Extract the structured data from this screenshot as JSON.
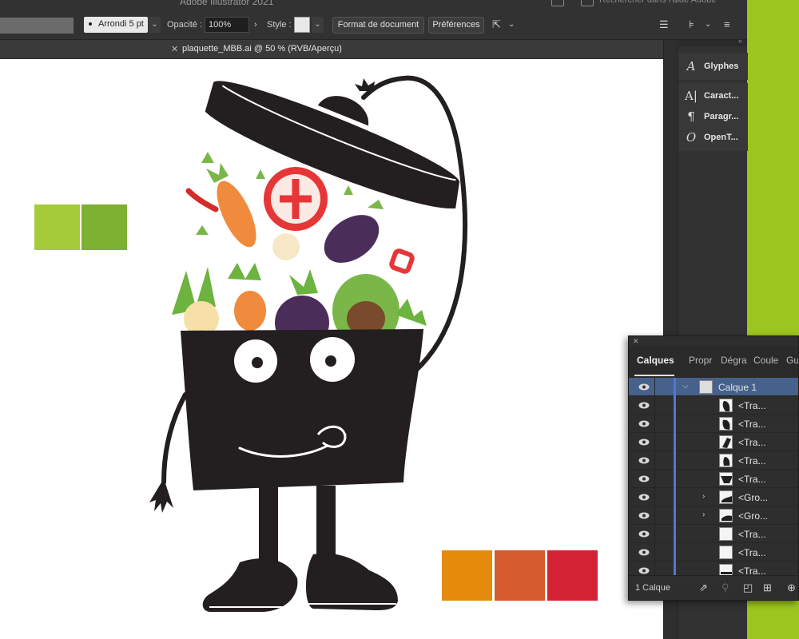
{
  "app": {
    "title": "Adobe Illustrator 2021",
    "search_placeholder": "Rechercher dans l'aide Adobe"
  },
  "control_bar": {
    "brush_value": "Arrondi 5 pt",
    "opacity_label": "Opacité :",
    "opacity_value": "100%",
    "style_label": "Style :",
    "document_setup_button": "Format de document",
    "preferences_button": "Préférences"
  },
  "document_tab": {
    "title": "plaquette_MBB.ai @ 50 % (RVB/Aperçu)"
  },
  "dock": {
    "items": [
      {
        "label": "Glyphes",
        "icon": "glyphs-icon",
        "glyph": "A"
      },
      {
        "label": "Caract...",
        "icon": "character-icon",
        "glyph": "A|"
      },
      {
        "label": "Paragr...",
        "icon": "paragraph-icon",
        "glyph": "¶"
      },
      {
        "label": "OpenT...",
        "icon": "opentype-icon",
        "glyph": "O"
      }
    ]
  },
  "swatches": {
    "greens": [
      "#a5cb3a",
      "#7eb032"
    ],
    "warms": [
      "#e48b0c",
      "#d55a2c",
      "#d42235"
    ]
  },
  "layers_panel": {
    "tabs": [
      "Calques",
      "Propr",
      "Dégra",
      "Coule",
      "Gu"
    ],
    "rows": [
      {
        "name": "Calque 1",
        "expanded": true,
        "top_level": true
      },
      {
        "name": "<Tra..."
      },
      {
        "name": "<Tra..."
      },
      {
        "name": "<Tra..."
      },
      {
        "name": "<Tra..."
      },
      {
        "name": "<Tra..."
      },
      {
        "name": "<Gro...",
        "collapsed_group": true
      },
      {
        "name": "<Gro...",
        "collapsed_group": true
      },
      {
        "name": "<Tra..."
      },
      {
        "name": "<Tra..."
      },
      {
        "name": "<Tra..."
      }
    ],
    "footer_count": "1 Calque"
  },
  "colors": {
    "selection": "#46618c",
    "layer_color": "#4f78d6",
    "background_green": "#9cc51d"
  }
}
